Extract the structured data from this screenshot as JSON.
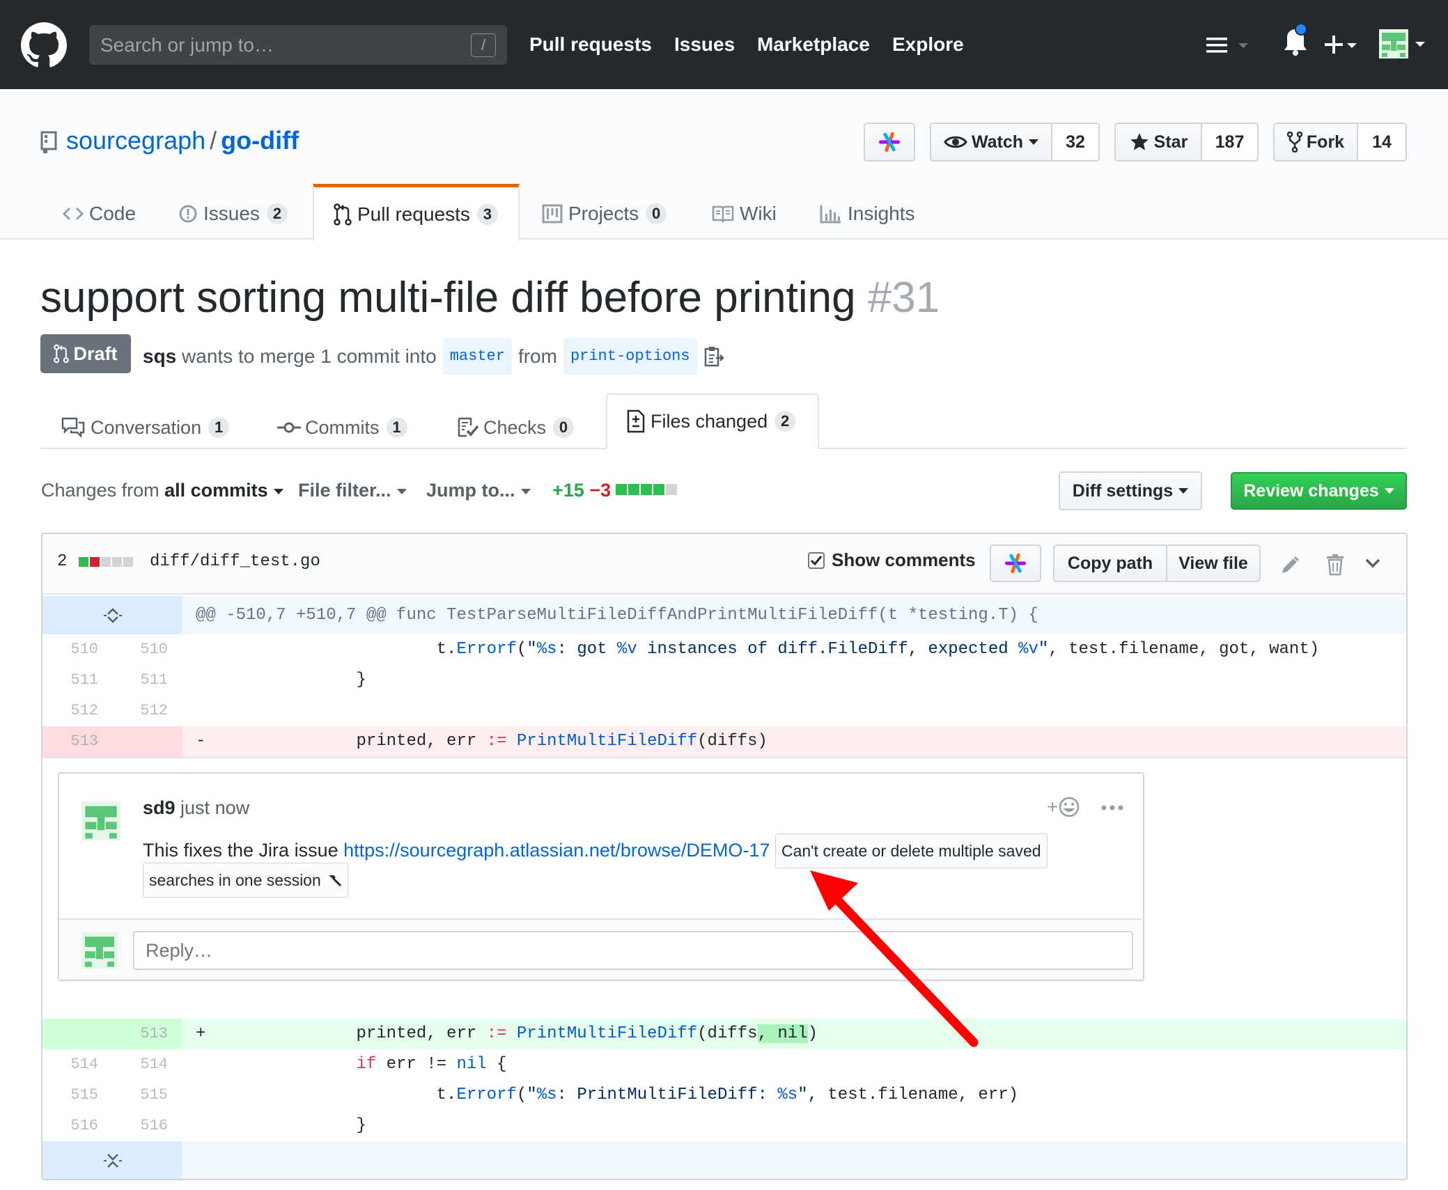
{
  "header": {
    "search_placeholder": "Search or jump to…",
    "slash_key": "/",
    "nav": [
      "Pull requests",
      "Issues",
      "Marketplace",
      "Explore"
    ]
  },
  "repo": {
    "owner": "sourcegraph",
    "separator": "/",
    "name": "go-diff",
    "watch_label": "Watch",
    "watch_count": "32",
    "star_label": "Star",
    "star_count": "187",
    "fork_label": "Fork",
    "fork_count": "14",
    "tabs": [
      {
        "label": "Code",
        "count": ""
      },
      {
        "label": "Issues",
        "count": "2"
      },
      {
        "label": "Pull requests",
        "count": "3"
      },
      {
        "label": "Projects",
        "count": "0"
      },
      {
        "label": "Wiki",
        "count": ""
      },
      {
        "label": "Insights",
        "count": ""
      }
    ]
  },
  "pr": {
    "title": "support sorting multi-file diff before printing",
    "number": "#31",
    "state": "Draft",
    "author": "sqs",
    "meta_text": "wants to merge 1 commit into",
    "base_branch": "master",
    "from_text": "from",
    "head_branch": "print-options",
    "tabs": [
      {
        "label": "Conversation",
        "count": "1"
      },
      {
        "label": "Commits",
        "count": "1"
      },
      {
        "label": "Checks",
        "count": "0"
      },
      {
        "label": "Files changed",
        "count": "2"
      }
    ]
  },
  "toolbar": {
    "changes_prefix": "Changes from",
    "changes_value": "all commits",
    "file_filter": "File filter...",
    "jump_to": "Jump to...",
    "additions": "+15",
    "deletions": "−3",
    "diff_settings": "Diff settings",
    "review_changes": "Review changes"
  },
  "file": {
    "change_count": "2",
    "path": "diff/diff_test.go",
    "show_comments": "Show comments",
    "copy_path": "Copy path",
    "view_file": "View file",
    "hunk_header": "@@ -510,7 +510,7 @@ func TestParseMultiFileDiffAndPrintMultiFileDiff(t *testing.T) {",
    "lines": {
      "l510": {
        "a": "510",
        "b": "510"
      },
      "l511": {
        "a": "511",
        "b": "511"
      },
      "l512": {
        "a": "512",
        "b": "512"
      },
      "l513del": {
        "a": "513",
        "marker": "-"
      },
      "l513add": {
        "b": "513",
        "marker": "+"
      },
      "l514": {
        "a": "514",
        "b": "514"
      },
      "l515": {
        "a": "515",
        "b": "515"
      },
      "l516": {
        "a": "516",
        "b": "516"
      }
    }
  },
  "comment": {
    "author": "sd9",
    "time": "just now",
    "text_prefix": "This fixes the Jira issue",
    "link": "https://sourcegraph.atlassian.net/browse/DEMO-17",
    "issue_title_line1": "Can't create or delete multiple saved",
    "issue_title_line2": "searches in one session",
    "reaction_plus": "+",
    "reply_placeholder": "Reply…"
  },
  "colors": {
    "header_bg": "#24292e",
    "link": "#0366d6",
    "added_bg": "#e6ffed",
    "deleted_bg": "#ffeef0",
    "hunk_bg": "#f1f8ff",
    "arrow": "#ff0000",
    "review_green": "#28a745"
  }
}
